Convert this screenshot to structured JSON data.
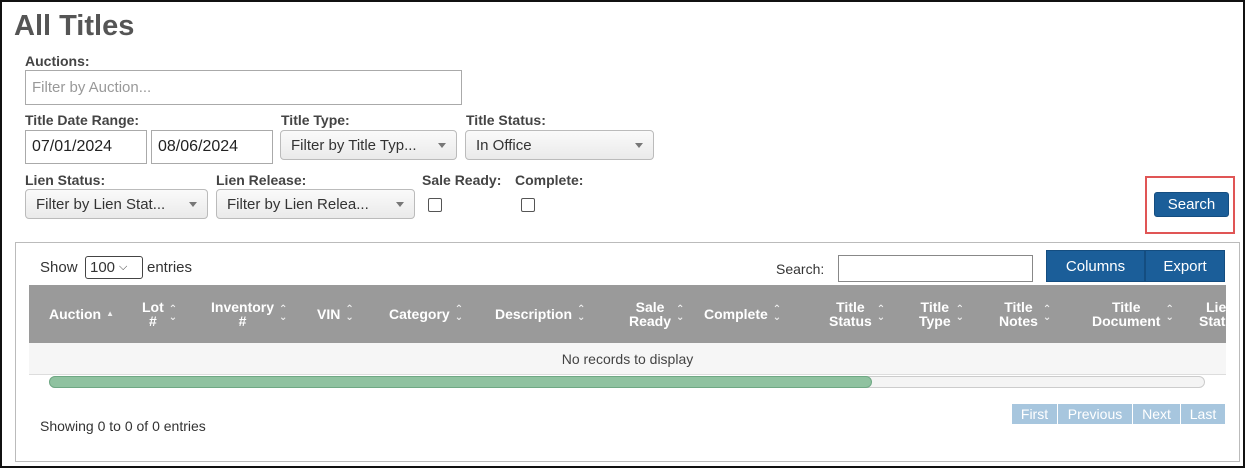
{
  "page": {
    "title": "All Titles"
  },
  "filters": {
    "auctions": {
      "label": "Auctions:",
      "placeholder": "Filter by Auction..."
    },
    "date_range": {
      "label": "Title Date Range:",
      "start": "07/01/2024",
      "end": "08/06/2024"
    },
    "title_type": {
      "label": "Title Type:",
      "value": "Filter by Title Typ..."
    },
    "title_status": {
      "label": "Title Status:",
      "value": "In Office"
    },
    "lien_status": {
      "label": "Lien Status:",
      "value": "Filter by Lien Stat..."
    },
    "lien_release": {
      "label": "Lien Release:",
      "value": "Filter by Lien Relea..."
    },
    "sale_ready": {
      "label": "Sale Ready:",
      "checked": false
    },
    "complete": {
      "label": "Complete:",
      "checked": false
    },
    "search_button": "Search"
  },
  "grid": {
    "show_label": "Show",
    "page_size": "100",
    "entries_label": "entries",
    "search_label": "Search:",
    "columns_button": "Columns",
    "export_button": "Export",
    "columns": [
      {
        "line1": "Auction",
        "line2": "",
        "sort": "asc"
      },
      {
        "line1": "Lot",
        "line2": "#",
        "sort": "both"
      },
      {
        "line1": "Inventory",
        "line2": "#",
        "sort": "both"
      },
      {
        "line1": "VIN",
        "line2": "",
        "sort": "both"
      },
      {
        "line1": "Category",
        "line2": "",
        "sort": "both"
      },
      {
        "line1": "Description",
        "line2": "",
        "sort": "both"
      },
      {
        "line1": "Sale",
        "line2": "Ready",
        "sort": "both"
      },
      {
        "line1": "Complete",
        "line2": "",
        "sort": "both"
      },
      {
        "line1": "Title",
        "line2": "Status",
        "sort": "both"
      },
      {
        "line1": "Title",
        "line2": "Type",
        "sort": "both"
      },
      {
        "line1": "Title",
        "line2": "Notes",
        "sort": "both"
      },
      {
        "line1": "Title",
        "line2": "Document",
        "sort": "both"
      },
      {
        "line1": "Lien",
        "line2": "Status",
        "sort": "both"
      }
    ],
    "empty_message": "No records to display",
    "scroll_position": 0.71,
    "footer_info": "Showing 0 to 0 of 0 entries",
    "pagination": [
      "First",
      "Previous",
      "Next",
      "Last"
    ]
  }
}
